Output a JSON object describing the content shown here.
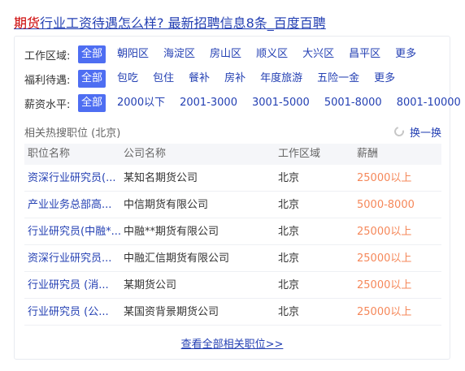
{
  "header": {
    "title_link": "期货行业工资待遇怎么样? 最新招聘信息8条_百度百聘"
  },
  "filters": {
    "area": {
      "label": "工作区域:",
      "options": [
        "全部",
        "朝阳区",
        "海淀区",
        "房山区",
        "顺义区",
        "大兴区",
        "昌平区",
        "更多"
      ],
      "selected": "全部"
    },
    "welfare": {
      "label": "福利待遇:",
      "options": [
        "全部",
        "包吃",
        "包住",
        "餐补",
        "房补",
        "年度旅游",
        "五险一金",
        "更多"
      ],
      "selected": "全部"
    },
    "salary": {
      "label": "薪资水平:",
      "options": [
        "全部",
        "2000以下",
        "2001-3000",
        "3001-5000",
        "5001-8000",
        "8001-10000"
      ],
      "selected": "全部"
    }
  },
  "related": {
    "title": "相关热搜职位 (北京)",
    "refresh_label": "换一换"
  },
  "table": {
    "headers": [
      "职位名称",
      "公司名称",
      "工作区域",
      "薪酬"
    ],
    "rows": [
      [
        "资深行业研究员(...",
        "某知名期货公司",
        "北京",
        "25000以上"
      ],
      [
        "产业业务总部高...",
        "中信期货有限公司",
        "北京",
        "5000-8000"
      ],
      [
        "行业研究员(中融*...",
        "中融**期货有限公司",
        "北京",
        "25000以上"
      ],
      [
        "资深行业研究员...",
        "中融汇信期货有限公司",
        "北京",
        "25000以上"
      ],
      [
        "行业研究员 (消...",
        "某期货公司",
        "北京",
        "25000以上"
      ],
      [
        "行业研究员 (公...",
        "某国资背景期货公司",
        "北京",
        "25000以上"
      ]
    ]
  },
  "footer": {
    "view_all": "查看全部相关职位>>"
  },
  "colors": {
    "link": "#2440b3",
    "active_bg": "#4e6ef2",
    "salary": "#f4733d",
    "highlight": "#cc0000"
  }
}
